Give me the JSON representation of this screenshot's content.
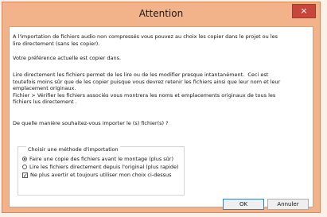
{
  "dialog": {
    "title": "Attention",
    "close_glyph": "×",
    "paragraph_1": "A l'importation de fichiers audio non compressés vous pouvez au choix les copier dans le projet ou les\nlire directement (sans les copier).",
    "paragraph_2": "Votre préférence actuelle est copier dans.",
    "paragraph_3": "Lire directement les fichiers permet de les lire ou de les modifier presque intantanément.  Ceci est\ntoutefois moins sûr que de les copier puisque vous devrez retenir les fichiers ainsi que leur nom et leur\nemplacement originaux.\nFichier > Vérifier les fichiers associés vous montrera les noms et emplacements originaux de tous les\nfichiers lus directement .",
    "question": "De quelle manière souhaitez-vous importer le (s) fichier(s) ?",
    "group_title": "Choisir une méthode d'importation",
    "options": [
      {
        "label": "Faire une copie des fichiers avant le montage (plus sûr)",
        "checked": true
      },
      {
        "label": "Lire les fichiers directement depuis l'original (plus rapide)",
        "checked": false
      }
    ],
    "remember": {
      "label": "Ne plus avertir et toujours utiliser mon choix ci-dessus",
      "checked": true
    },
    "ok_label": "OK",
    "cancel_label": "Annuler"
  },
  "colors": {
    "frame": "#f2b38a",
    "close_button": "#c7463c",
    "client_background": "#ffffff"
  }
}
